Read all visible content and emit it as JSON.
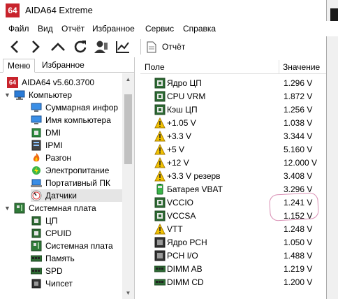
{
  "window": {
    "logo": "64",
    "title": "AIDA64 Extreme"
  },
  "menubar": [
    "Файл",
    "Вид",
    "Отчёт",
    "Избранное",
    "Сервис",
    "Справка"
  ],
  "toolbar": {
    "report_label": "Отчёт",
    "buttons": [
      "back-icon",
      "forward-icon",
      "up-icon",
      "refresh-icon",
      "user-icon",
      "chart-icon"
    ]
  },
  "tabs": [
    "Меню",
    "Избранное"
  ],
  "tree": {
    "root": "AIDA64 v5.60.3700",
    "computer": "Компьютер",
    "computer_items": [
      "Суммарная инфор",
      "Имя компьютера",
      "DMI",
      "IPMI",
      "Разгон",
      "Электропитание",
      "Портативный ПК",
      "Датчики"
    ],
    "motherboard": "Системная плата",
    "motherboard_items": [
      "ЦП",
      "CPUID",
      "Системная плата",
      "Память",
      "SPD",
      "Чипсет"
    ]
  },
  "columns": {
    "field": "Поле",
    "value": "Значение"
  },
  "sensors": [
    {
      "name": "Ядро ЦП",
      "value": "1.296 V",
      "icon": "chip"
    },
    {
      "name": "CPU VRM",
      "value": "1.872 V",
      "icon": "chip"
    },
    {
      "name": "Кэш ЦП",
      "value": "1.256 V",
      "icon": "chip"
    },
    {
      "name": "+1.05 V",
      "value": "1.038 V",
      "icon": "warning"
    },
    {
      "name": "+3.3 V",
      "value": "3.344 V",
      "icon": "warning"
    },
    {
      "name": "+5 V",
      "value": "5.160 V",
      "icon": "warning"
    },
    {
      "name": "+12 V",
      "value": "12.000 V",
      "icon": "warning"
    },
    {
      "name": "+3.3 V резерв",
      "value": "3.408 V",
      "icon": "warning"
    },
    {
      "name": "Батарея VBAT",
      "value": "3.296 V",
      "icon": "battery"
    },
    {
      "name": "VCCIO",
      "value": "1.241 V",
      "icon": "chip"
    },
    {
      "name": "VCCSA",
      "value": "1.152 V",
      "icon": "chip"
    },
    {
      "name": "VTT",
      "value": "1.248 V",
      "icon": "warning"
    },
    {
      "name": "Ядро PCH",
      "value": "1.050 V",
      "icon": "pch"
    },
    {
      "name": "PCH I/O",
      "value": "1.488 V",
      "icon": "pch"
    },
    {
      "name": "DIMM AB",
      "value": "1.219 V",
      "icon": "dimm"
    },
    {
      "name": "DIMM CD",
      "value": "1.200 V",
      "icon": "dimm"
    }
  ],
  "colors": {
    "logo_red": "#c8232c",
    "chip_green": "#2e6b34",
    "warning_yellow": "#f2c200",
    "highlight_pink": "#d98fb4",
    "selection_gray": "#e5e5e5"
  }
}
